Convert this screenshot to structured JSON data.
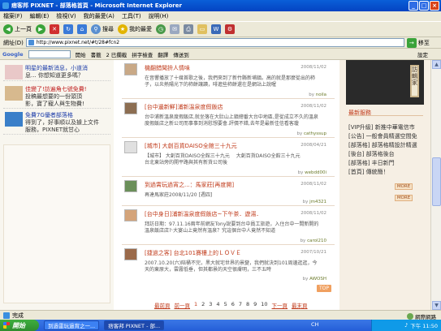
{
  "window": {
    "title": "痞客邦 PIXNET - 部落格首頁 - Microsoft Internet Explorer",
    "minimize": "_",
    "maximize": "□",
    "close": "×"
  },
  "menu": [
    "檔案(F)",
    "編輯(E)",
    "檢視(V)",
    "我的最愛(A)",
    "工具(T)",
    "說明(H)"
  ],
  "toolbar": {
    "back": "上一頁",
    "search": "搜尋",
    "favorites": "我的最愛"
  },
  "address": {
    "label": "網址(D)",
    "url": "http://www.pixnet.net/#t/28#fcn2",
    "go": "移至"
  },
  "google_bar": {
    "brand": "Google",
    "start": "開始",
    "bookmarks": "書籤",
    "blocked": "2 已攔截",
    "spellcheck": "拼字檢查",
    "translate": "翻譯",
    "send": "傳送到",
    "settings": "設定"
  },
  "left_items": [
    {
      "tag": "",
      "lines": [
        "明星的最新消息，小道消",
        "息... 你想知道更多嗎？"
      ]
    },
    {
      "tag": "",
      "lines": [
        "佳變了!訪遍角七號免費!",
        "投稿最想要的一份頭頂",
        "影，寶了寵人與生物費!"
      ]
    },
    {
      "tag": "",
      "lines": [
        "免費7G優者部落格",
        "得到了，好事順以及據上文件",
        "服務，PIXNET就甘心"
      ]
    }
  ],
  "posts": [
    {
      "title": "機翻錯聞拚人情味",
      "date": "2008/11/02",
      "body": [
        "在音響播放了十幾首歌之後，我們來到了新竹縣新埔鎮。高的就是那麼從出的柿",
        "子，以炎熱陽光下的柿餅讓讀，啡進些柿餅還在是網站上說喔"
      ],
      "by": "noila"
    },
    {
      "title": "[台中邊新鮮]浦新溫泉度假飯店",
      "date": "2008/11/02",
      "body": [
        "台中浦新溫泉度假飯店,就坐落在大肚山上鎮總番大台中地區,是從成立不久的溫泉",
        "度假飯店之新公司而事事到消慰想要會.評價不錯,去年是最新佳信看客瓊"
      ],
      "by": "cathyssup"
    },
    {
      "title": "[城市] 大創百貨DAISO全館三十九元",
      "date": "2008/04/21",
      "body": [
        "【城市】 大創百貨DAISO全館三十九元 　大創百貨DAISO全館三十九元",
        "台北東站旁的開平路與其有新貨公司後"
      ],
      "by": "webdd00i"
    },
    {
      "title": "到過霄玩過宵之...：馬家莊[再度開]",
      "date": "2008/11/02",
      "body": [
        "再達馬家莊2008/11/20 [週四]"
      ],
      "by": "jm4321"
    },
    {
      "title": "[台中身日]浦新溫泉度假飯店~下午茶．遊湯．",
      "date": "2008/11/02",
      "body": [
        "拜訪日期：97.11.16兩年前網友Tony說要到台中員工旅遊，入住台中一間新開的",
        "溫泉飯店店?·大宴山上竟然有溫泉？究這個台中人竟然不知道"
      ],
      "by": "carol210"
    },
    {
      "title": "[捷過之客] 台北101賽樓上的ＬＯＶＥ",
      "date": "2007/10/21",
      "body": [
        "2007.10.20(六)陪桶不完，黑大就宅世界的景變，我們就決到101周邊逛逛，今",
        "天的東原大，雲霧低垂，但其都景的天空很膚明，三不五時"
      ],
      "by": "AWOSH"
    }
  ],
  "top_btn": "TOP",
  "pager": {
    "first": "最前頁",
    "prev": "前一頁",
    "pages": [
      "1",
      "2",
      "3",
      "4",
      "5",
      "6",
      "7",
      "8",
      "9",
      "10"
    ],
    "next": "下一頁",
    "last": "最末頁"
  },
  "right": {
    "sign": "訪輯家",
    "title": "最新服務",
    "items": [
      "[VIP升級] 新推中華電信市",
      "[公告] 一般會員精選空間免",
      "[部落格] 部落格精設計精選",
      "[後台] 部落格後台",
      "[部落格] 丰日新門",
      "[首頁] 傳統簡！"
    ],
    "more1": "MORE",
    "more2": "MORE"
  },
  "status": {
    "text": "完成",
    "zone": "網際網路"
  },
  "taskbar": {
    "start": "開始",
    "tasks": [
      "到過雷玩過宵之一...",
      "痞客邦 PIXNET - 部..."
    ],
    "lang": "CH",
    "clock": "下午 11:50"
  }
}
